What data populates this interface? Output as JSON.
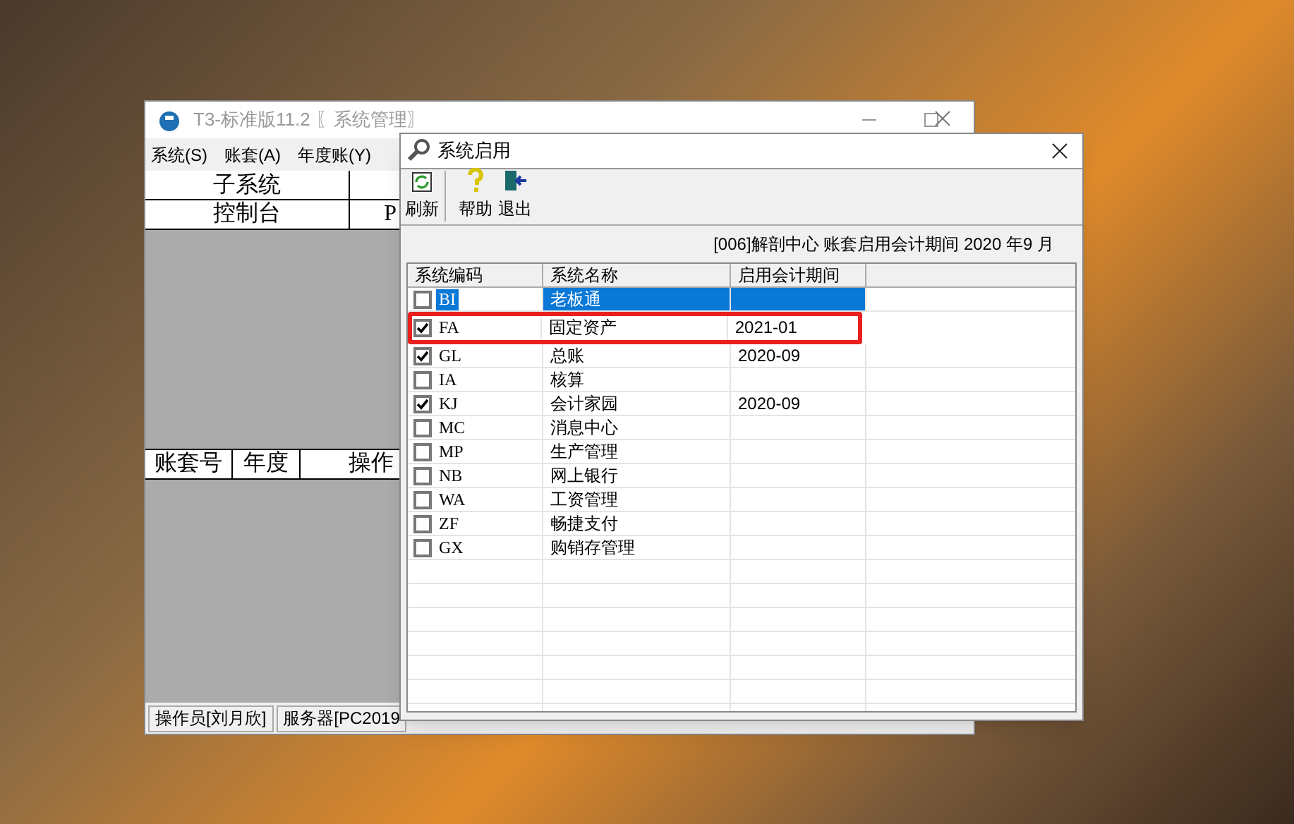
{
  "main_window": {
    "title": "T3-标准版11.2 〖系统管理〗",
    "menu": [
      "系统(S)",
      "账套(A)",
      "年度账(Y)"
    ],
    "subsystem_table": {
      "columns": [
        "子系统"
      ],
      "rows": [
        {
          "cells": [
            "控制台",
            "P"
          ]
        }
      ]
    },
    "account_table": {
      "columns": [
        "账套号",
        "年度",
        "操作"
      ]
    },
    "status_bar": [
      "操作员[刘月欣]",
      "服务器[PC2019"
    ]
  },
  "dialog": {
    "title": "系统启用",
    "toolbar": [
      {
        "label": "刷新",
        "kind": "refresh"
      },
      {
        "label": "帮助",
        "kind": "help"
      },
      {
        "label": "退出",
        "kind": "exit"
      }
    ],
    "info": "[006]解剖中心 账套启用会计期间 2020 年9 月",
    "table": {
      "columns": [
        "系统编码",
        "系统名称",
        "启用会计期间"
      ],
      "rows": [
        {
          "code": "BI",
          "name": "老板通",
          "period": "",
          "checked": false,
          "selected": true,
          "marked": false
        },
        {
          "code": "FA",
          "name": "固定资产",
          "period": "2021-01",
          "checked": true,
          "selected": false,
          "marked": true
        },
        {
          "code": "GL",
          "name": "总账",
          "period": "2020-09",
          "checked": true,
          "selected": false,
          "marked": false
        },
        {
          "code": "IA",
          "name": "核算",
          "period": "",
          "checked": false,
          "selected": false,
          "marked": false
        },
        {
          "code": "KJ",
          "name": "会计家园",
          "period": "2020-09",
          "checked": true,
          "selected": false,
          "marked": false
        },
        {
          "code": "MC",
          "name": "消息中心",
          "period": "",
          "checked": false,
          "selected": false,
          "marked": false
        },
        {
          "code": "MP",
          "name": "生产管理",
          "period": "",
          "checked": false,
          "selected": false,
          "marked": false
        },
        {
          "code": "NB",
          "name": "网上银行",
          "period": "",
          "checked": false,
          "selected": false,
          "marked": false
        },
        {
          "code": "WA",
          "name": "工资管理",
          "period": "",
          "checked": false,
          "selected": false,
          "marked": false
        },
        {
          "code": "ZF",
          "name": "畅捷支付",
          "period": "",
          "checked": false,
          "selected": false,
          "marked": false
        },
        {
          "code": "GX",
          "name": "购销存管理",
          "period": "",
          "checked": false,
          "selected": false,
          "marked": false
        }
      ]
    }
  }
}
